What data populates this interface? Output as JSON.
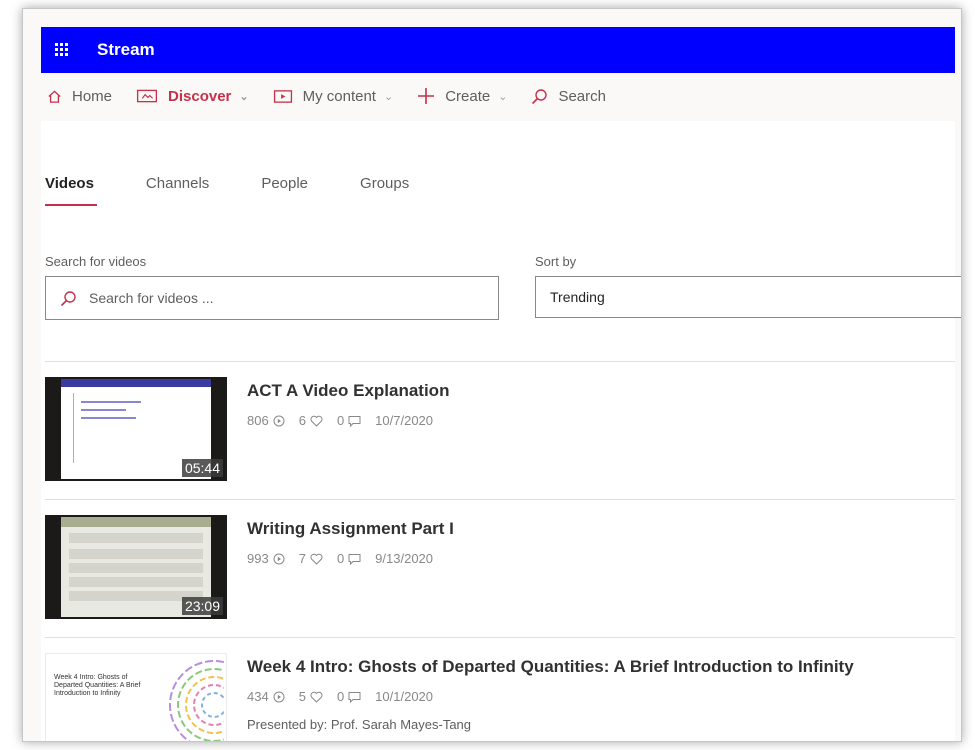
{
  "app": {
    "name": "Stream"
  },
  "nav": {
    "home": "Home",
    "discover": "Discover",
    "my_content": "My content",
    "create": "Create",
    "search": "Search"
  },
  "tabs": [
    "Videos",
    "Channels",
    "People",
    "Groups"
  ],
  "filters": {
    "search_label": "Search for videos",
    "search_placeholder": "Search for videos ...",
    "sort_label": "Sort by",
    "sort_value": "Trending"
  },
  "videos": [
    {
      "title": "ACT A Video Explanation",
      "views": "806",
      "likes": "6",
      "comments": "0",
      "date": "10/7/2020",
      "duration": "05:44"
    },
    {
      "title": "Writing Assignment Part I",
      "views": "993",
      "likes": "7",
      "comments": "0",
      "date": "9/13/2020",
      "duration": "23:09"
    },
    {
      "title": "Week 4 Intro: Ghosts of Departed Quantities: A Brief Introduction to Infinity",
      "views": "434",
      "likes": "5",
      "comments": "0",
      "date": "10/1/2020",
      "presenter": "Presented by: Prof. Sarah Mayes-Tang",
      "thumb_text": "Week 4 Intro: Ghosts of Departed Quantities: A Brief Introduction to Infinity"
    }
  ],
  "colors": {
    "brand_bar": "#0000ff",
    "accent": "#c4314b"
  }
}
